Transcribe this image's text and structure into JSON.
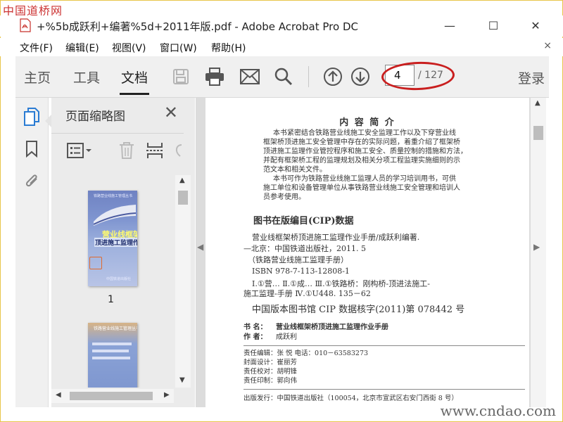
{
  "watermarks": {
    "top_left": "中国道桥网",
    "bottom_right": "www.cndao.com"
  },
  "window": {
    "title": "+%5b成跃利+编著%5d+2011年版.pdf - Adobe Acrobat Pro DC",
    "controls": {
      "minimize": "—",
      "maximize": "☐",
      "close": "✕"
    }
  },
  "menu": {
    "items": [
      "文件(F)",
      "编辑(E)",
      "视图(V)",
      "窗口(W)",
      "帮助(H)"
    ],
    "close": "×"
  },
  "toolbar": {
    "tabs": [
      "主页",
      "工具",
      "文档"
    ],
    "active_tab": "文档",
    "icons": [
      "save-icon",
      "print-icon",
      "mail-icon",
      "search-icon",
      "page-up-icon",
      "page-down-icon"
    ],
    "page_current": "4",
    "page_total": "/ 127",
    "login": "登录"
  },
  "sidebar_rail": {
    "icons": [
      "page-thumbnails-icon",
      "bookmark-icon",
      "attachment-icon"
    ]
  },
  "thumbnail_panel": {
    "title": "页面缩略图",
    "close": "✕",
    "pages": [
      {
        "label": "1",
        "series": "铁路营业线施工管理丛书",
        "cover_title": "营业线框架桥",
        "cover_subtitle": "顶进施工监理作业手册",
        "publisher": "中国铁道出版社"
      },
      {
        "label": "",
        "header": "铁路营业线施工管理丛书"
      }
    ]
  },
  "document": {
    "heading": "内 容 简 介",
    "intro_lines": [
      "本书紧密结合铁路营业线施工安全监理工作以及下穿营业线",
      "框架桥顶进施工安全管理中存在的实际问题，着重介绍了框架桥",
      "顶进施工监理作业管控程序和施工安全、质量控制的措施和方法，",
      "并配有框架桥工程的监理规划及相关分项工程监理实施细则的示",
      "范文本和相关文件。",
      "本书可作为铁路营业线施工监理人员的学习培训用书，可供",
      "施工单位和设备管理单位从事铁路营业线施工安全管理和培训人",
      "员参考使用。"
    ],
    "cip_title": "图书在版编目(CIP)数据",
    "cip_lines": [
      "营业线框架桥顶进施工监理作业手册/成跃利编著.",
      "—北京：中国铁道出版社，2011. 5",
      "（铁路营业线施工监理手册）",
      "ISBN 978-7-113-12808-1",
      "Ⅰ.①营…  Ⅱ.①成…  Ⅲ.①铁路桥：刚构桥-顶进法施工-",
      "施工监理-手册  Ⅳ.①U448. 135－62"
    ],
    "cip_number": "中国版本图书馆 CIP 数据核字(2011)第 078442 号",
    "book_title_label": "书    名：",
    "book_title": "营业线框架桥顶进施工监理作业手册",
    "author_label": "作    者：",
    "author": "成跃利",
    "credits": [
      "责任编辑：张  悦    电话：010－63583273",
      "封面设计：崔丽芳",
      "责任校对：胡明锋",
      "责任印制：郭向伟"
    ],
    "publisher_line": "出版发行：中国铁道出版社（100054，北京市宣武区右安门西街 8 号）"
  }
}
